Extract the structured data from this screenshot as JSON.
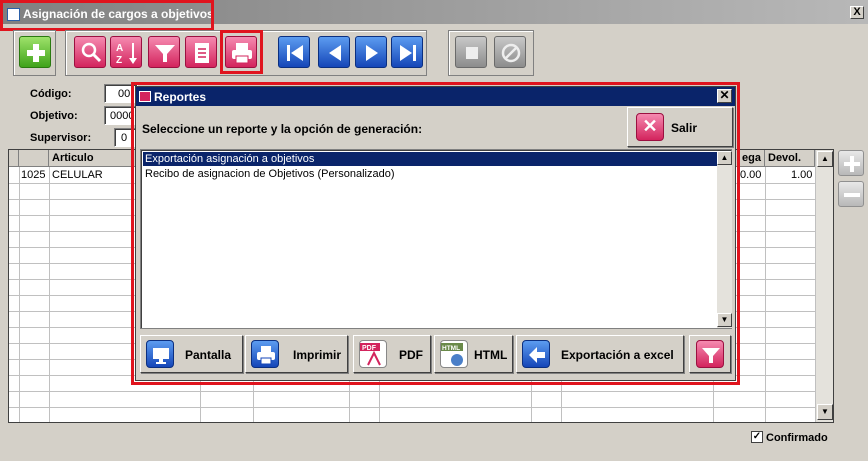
{
  "window": {
    "title": "Asignación de cargos a objetivos",
    "close_label": "X"
  },
  "toolbar": {
    "buttons": [
      {
        "name": "add-button",
        "icon": "plus-icon"
      },
      {
        "name": "search-button",
        "icon": "search-icon"
      },
      {
        "name": "sort-button",
        "icon": "sort-az-icon"
      },
      {
        "name": "filter-button",
        "icon": "filter-icon"
      },
      {
        "name": "report-list-button",
        "icon": "report-icon"
      },
      {
        "name": "print-button",
        "icon": "printer-icon"
      },
      {
        "name": "first-record-button",
        "icon": "first-icon"
      },
      {
        "name": "previous-record-button",
        "icon": "previous-icon"
      },
      {
        "name": "next-record-button",
        "icon": "next-icon"
      },
      {
        "name": "last-record-button",
        "icon": "last-icon"
      },
      {
        "name": "stop-button",
        "icon": "stop-icon"
      },
      {
        "name": "cancel-button",
        "icon": "cancel-icon"
      }
    ]
  },
  "form": {
    "codigo_label": "Código:",
    "codigo_value": "00",
    "objetivo_label": "Objetivo:",
    "objetivo_value": "0000",
    "supervisor_label": "Supervisor:",
    "supervisor_value": "0"
  },
  "grid": {
    "columns": [
      "Articulo",
      "ega",
      "Devol."
    ],
    "rows": [
      {
        "codigo": "1025",
        "articulo": "CELULAR",
        "entrega": "0.00",
        "devol": "1.00"
      }
    ]
  },
  "confirmado": {
    "label": "Confirmado",
    "checked": true,
    "mark": "✓"
  },
  "dialog": {
    "title": "Reportes",
    "close_label": "✕",
    "prompt": "Seleccione un reporte y la opción de generación:",
    "salir_label": "Salir",
    "salir_icon_glyph": "✕",
    "reports": [
      "Exportación asignación a objetivos",
      "Recibo de asignacion de Objetivos (Personalizado)"
    ],
    "selected_index": 0,
    "buttons": {
      "pantalla": "Pantalla",
      "imprimir": "Imprimir",
      "pdf": "PDF",
      "pdf_icon_text": "PDF",
      "html": "HTML",
      "html_icon_text": "HTML",
      "excel": "Exportación a excel"
    }
  },
  "colors": {
    "highlight": "#e0141e",
    "dialog_title": "#0a246a",
    "accent_pink": "#d3245d",
    "accent_blue": "#1546b8",
    "accent_green": "#3fa31a"
  }
}
